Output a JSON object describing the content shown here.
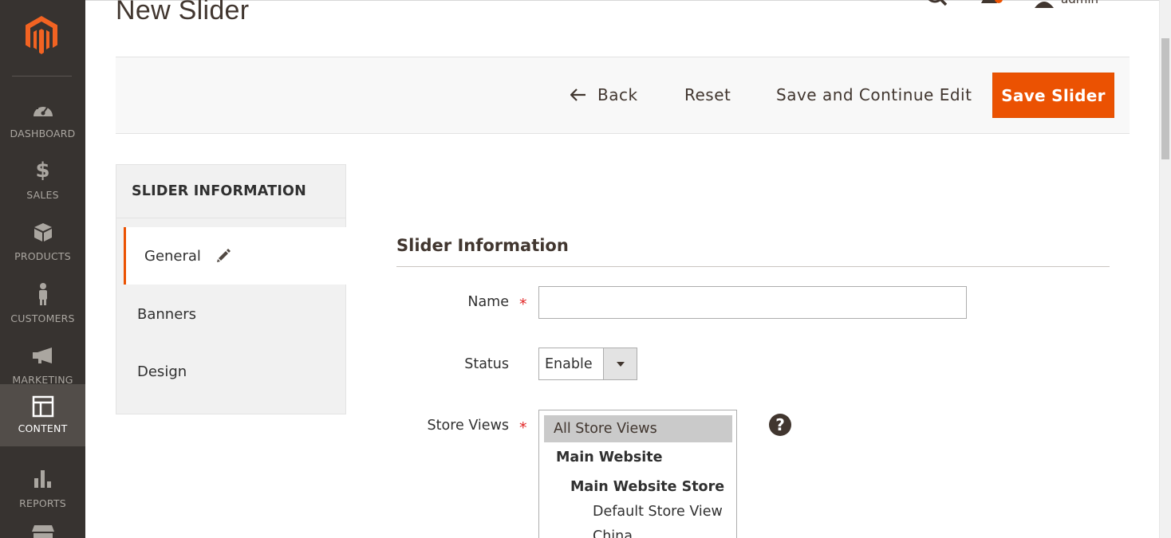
{
  "page": {
    "title": "New Slider"
  },
  "header": {
    "user_name": "admin"
  },
  "sidebar": {
    "items": [
      {
        "label": "DASHBOARD",
        "icon": "dashboard-icon"
      },
      {
        "label": "SALES",
        "icon": "dollar-icon"
      },
      {
        "label": "PRODUCTS",
        "icon": "cube-icon"
      },
      {
        "label": "CUSTOMERS",
        "icon": "person-icon"
      },
      {
        "label": "MARKETING",
        "icon": "megaphone-icon"
      },
      {
        "label": "CONTENT",
        "icon": "layout-icon",
        "active": true
      },
      {
        "label": "REPORTS",
        "icon": "bar-chart-icon"
      },
      {
        "label": "",
        "icon": "store-icon"
      }
    ]
  },
  "toolbar": {
    "back_label": "Back",
    "reset_label": "Reset",
    "save_continue_label": "Save and Continue Edit",
    "save_label": "Save Slider"
  },
  "tabs": {
    "title": "SLIDER INFORMATION",
    "items": [
      {
        "label": "General",
        "active": true
      },
      {
        "label": "Banners"
      },
      {
        "label": "Design"
      }
    ]
  },
  "form": {
    "section_title": "Slider Information",
    "name": {
      "label": "Name",
      "value": ""
    },
    "status": {
      "label": "Status",
      "value": "Enable"
    },
    "store_views": {
      "label": "Store Views",
      "options": [
        "All Store Views",
        "Main Website",
        "Main Website Store",
        "Default Store View",
        "China"
      ]
    },
    "help_glyph": "?"
  },
  "colors": {
    "accent": "#eb5202",
    "sidebar_bg": "#373330",
    "sidebar_active": "#524d49"
  }
}
